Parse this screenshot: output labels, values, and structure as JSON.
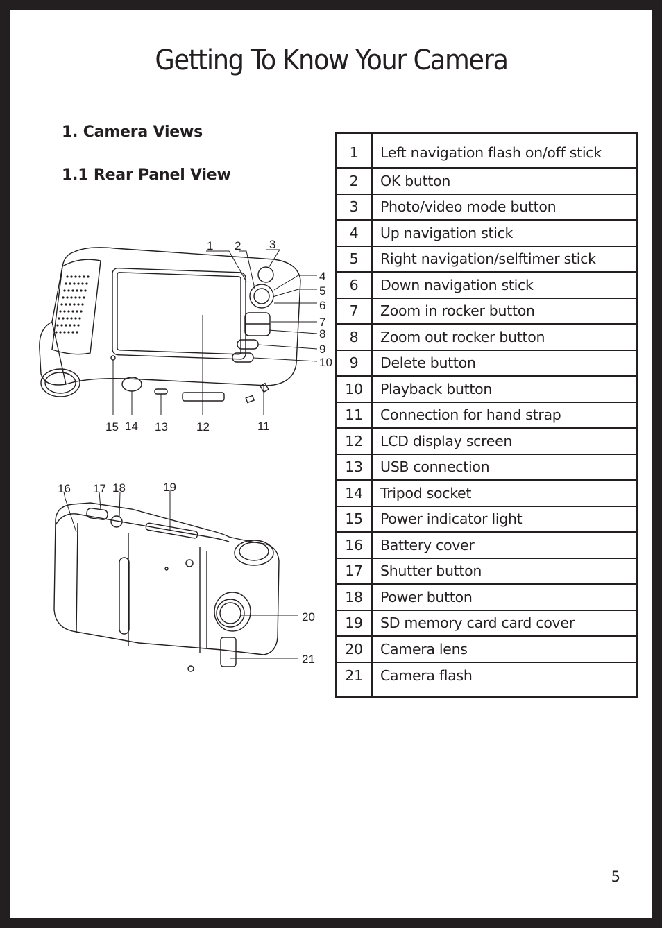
{
  "page": {
    "title": "Getting To Know Your Camera",
    "section_heading": "1. Camera Views",
    "subsection_heading": "1.1 Rear Panel View",
    "page_number": "5"
  },
  "parts": [
    {
      "num": "1",
      "label": "Left navigation flash on/off stick"
    },
    {
      "num": "2",
      "label": "OK button"
    },
    {
      "num": "3",
      "label": "Photo/video mode button"
    },
    {
      "num": "4",
      "label": "Up navigation stick"
    },
    {
      "num": "5",
      "label": "Right navigation/selftimer stick"
    },
    {
      "num": "6",
      "label": "Down navigation stick"
    },
    {
      "num": "7",
      "label": "Zoom in rocker button"
    },
    {
      "num": "8",
      "label": "Zoom out rocker button"
    },
    {
      "num": "9",
      "label": "Delete button"
    },
    {
      "num": "10",
      "label": "Playback button"
    },
    {
      "num": "11",
      "label": "Connection for hand strap"
    },
    {
      "num": "12",
      "label": "LCD display screen"
    },
    {
      "num": "13",
      "label": "USB connection"
    },
    {
      "num": "14",
      "label": "Tripod socket"
    },
    {
      "num": "15",
      "label": "Power indicator light"
    },
    {
      "num": "16",
      "label": "Battery cover"
    },
    {
      "num": "17",
      "label": "Shutter button"
    },
    {
      "num": "18",
      "label": "Power button"
    },
    {
      "num": "19",
      "label": "SD memory card card cover"
    },
    {
      "num": "20",
      "label": "Camera lens"
    },
    {
      "num": "21",
      "label": "Camera flash"
    }
  ],
  "rear_diagram": {
    "callouts": [
      "1",
      "2",
      "3",
      "4",
      "5",
      "6",
      "7",
      "8",
      "9",
      "10",
      "11",
      "12",
      "13",
      "14",
      "15"
    ]
  },
  "front_diagram": {
    "callouts": [
      "16",
      "17",
      "18",
      "19",
      "20",
      "21"
    ]
  }
}
